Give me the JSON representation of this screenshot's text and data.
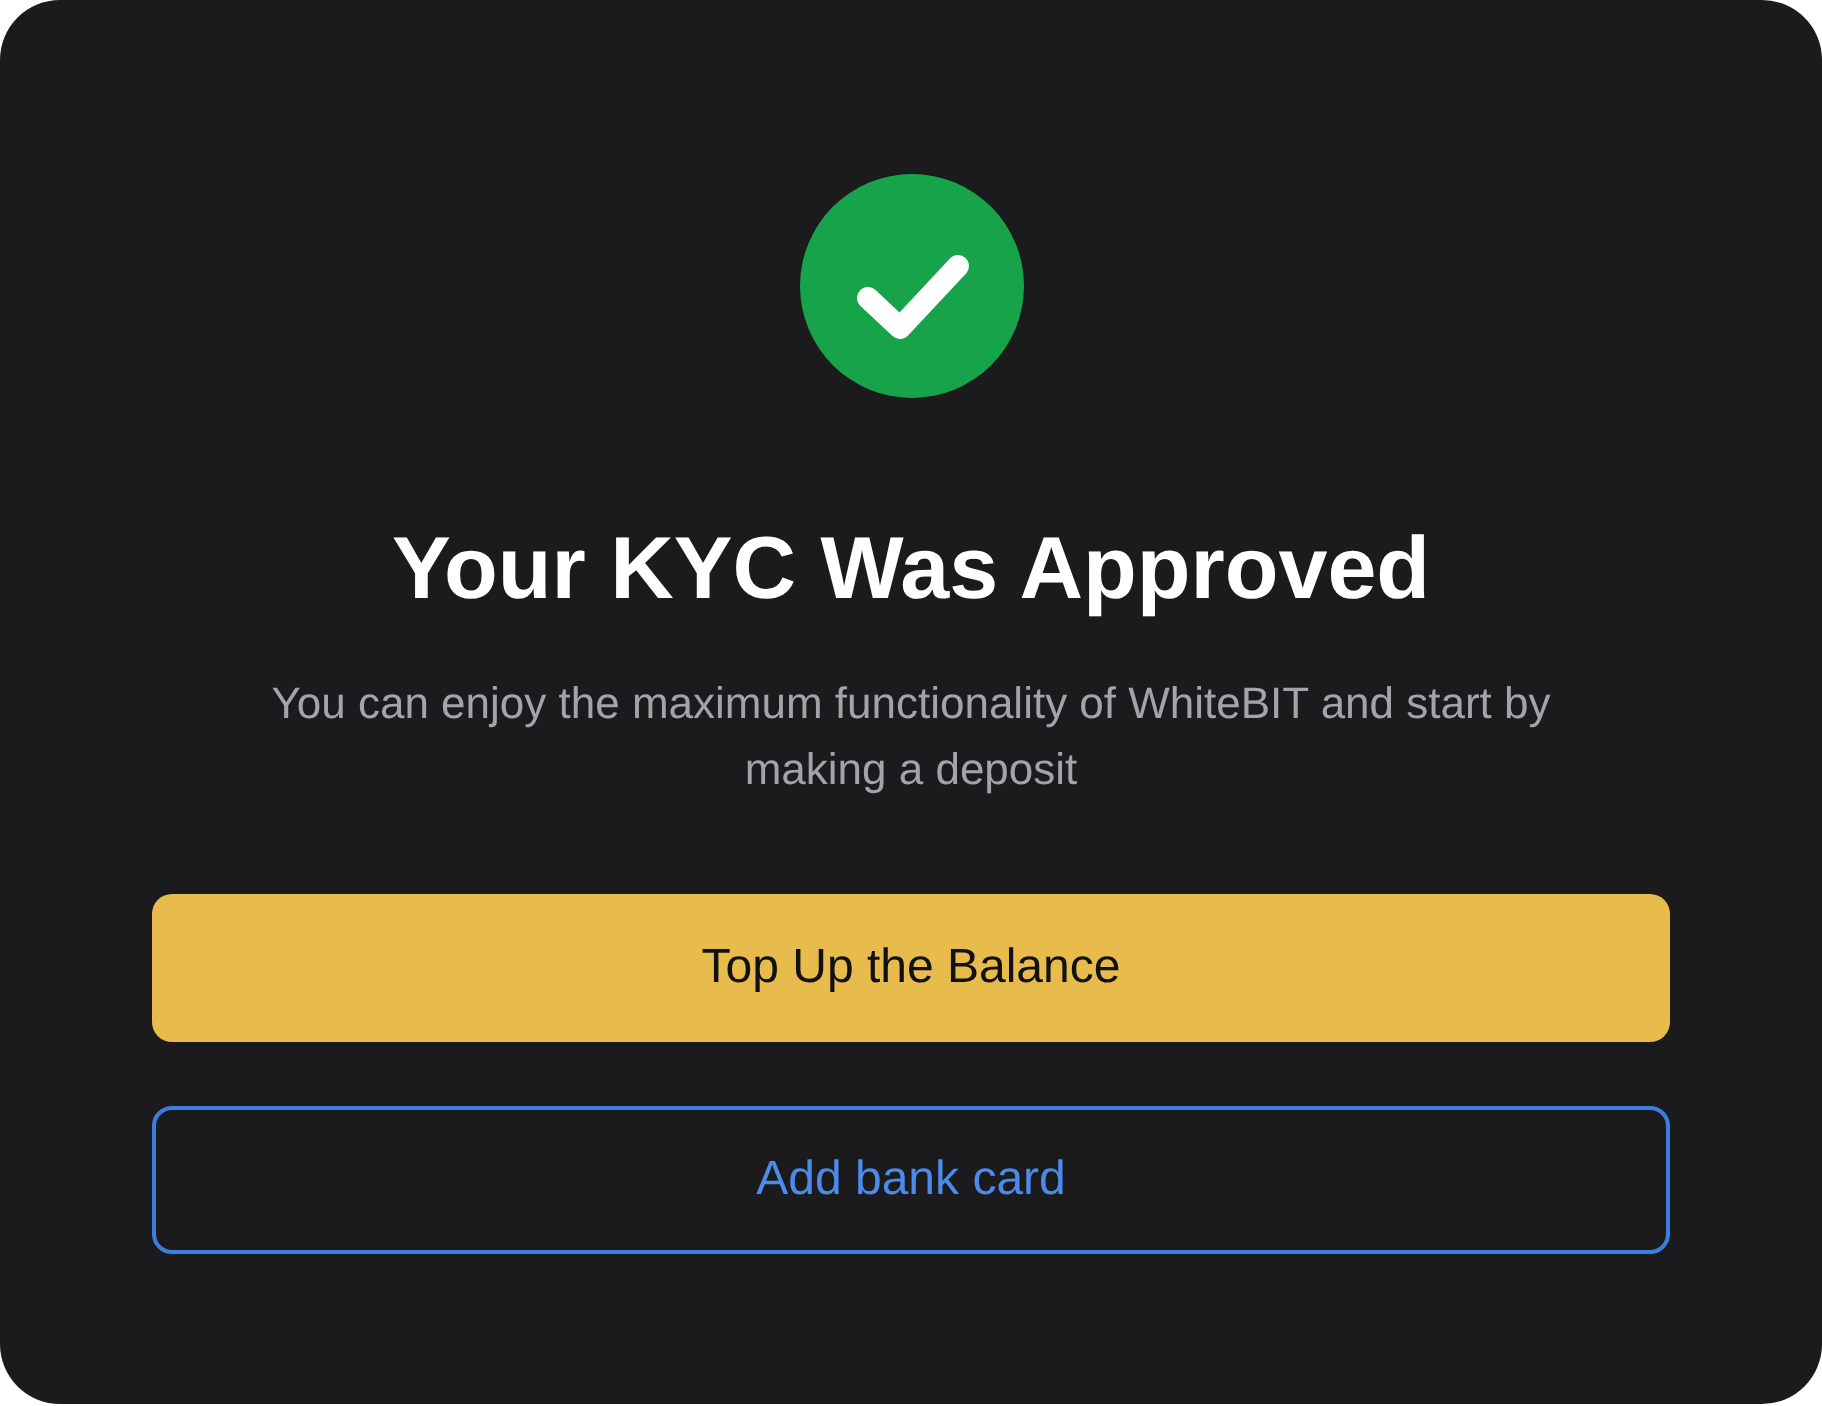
{
  "status": {
    "kind": "success"
  },
  "title": "Your KYC Was Approved",
  "description": "You can enjoy the maximum functionality of WhiteBIT and start by making a deposit",
  "buttons": [
    {
      "label": "Top Up the Balance",
      "kind": "primary"
    },
    {
      "label": "Add bank card",
      "kind": "outline"
    }
  ]
}
